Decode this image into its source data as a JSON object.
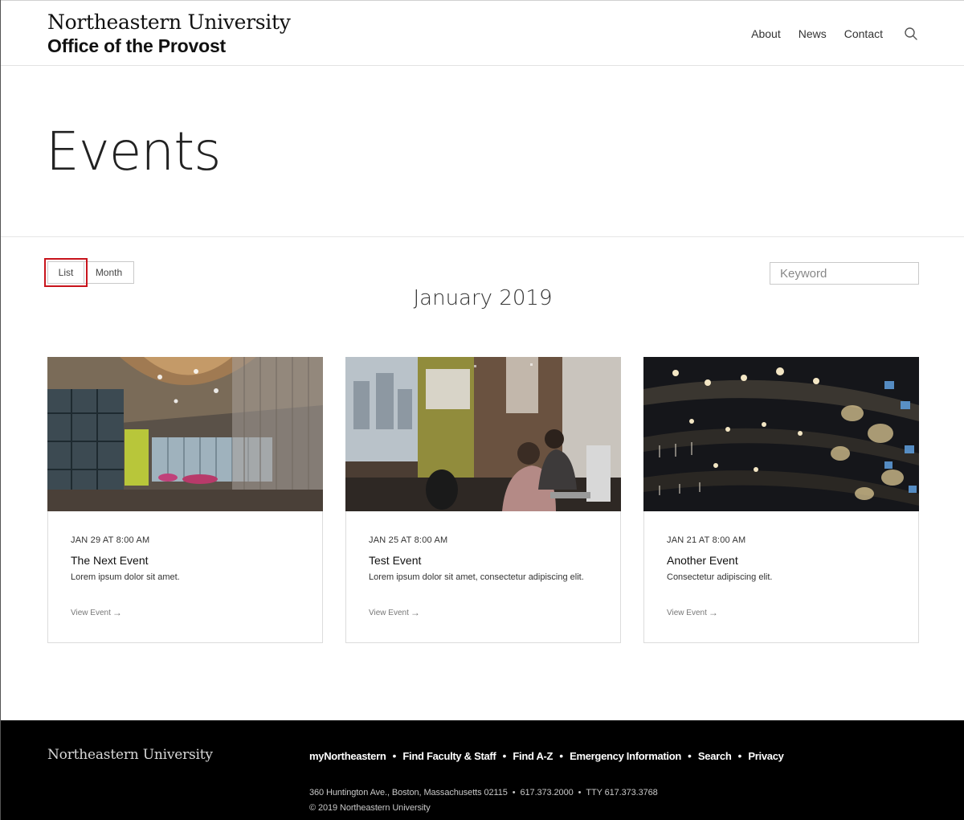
{
  "header": {
    "brand_university": "Northeastern University",
    "brand_office": "Office of the Provost",
    "nav": [
      "About",
      "News",
      "Contact"
    ],
    "search_icon": "search-icon"
  },
  "hero": {
    "title": "Events"
  },
  "controls": {
    "view_list_label": "List",
    "view_month_label": "Month",
    "selected_view": "List",
    "keyword_placeholder": "Keyword",
    "highlight_color": "#c8141c"
  },
  "calendar": {
    "month_heading": "January 2019"
  },
  "events": [
    {
      "date": "JAN 29 AT 8:00 AM",
      "title": "The Next Event",
      "description": "Lorem ipsum dolor sit amet.",
      "link_label": "View Event",
      "link_icon": "arrow-right-icon"
    },
    {
      "date": "JAN 25 AT 8:00 AM",
      "title": "Test Event",
      "description": "Lorem ipsum dolor sit amet, consectetur adipiscing elit.",
      "link_label": "View Event",
      "link_icon": "arrow-right-icon"
    },
    {
      "date": "JAN 21 AT 8:00 AM",
      "title": "Another Event",
      "description": "Consectetur adipiscing elit.",
      "link_label": "View Event",
      "link_icon": "arrow-right-icon"
    }
  ],
  "footer": {
    "brand": "Northeastern University",
    "links": [
      "myNortheastern",
      "Find Faculty & Staff",
      "Find A-Z",
      "Emergency Information",
      "Search",
      "Privacy"
    ],
    "address": "360 Huntington Ave., Boston, Massachusetts 02115",
    "phone": "617.373.2000",
    "tty": "TTY 617.373.3768",
    "copyright": "© 2019 Northeastern University"
  }
}
